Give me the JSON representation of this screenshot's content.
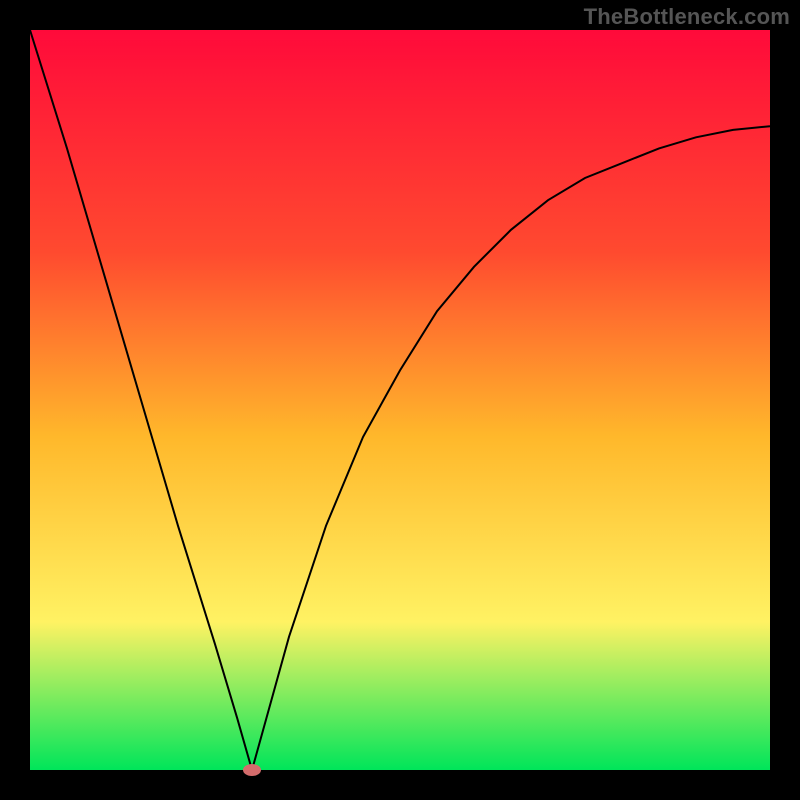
{
  "watermark": "TheBottleneck.com",
  "colors": {
    "bg_black": "#000000",
    "grad_top": "#ff0a3a",
    "grad_upper": "#ff4a2f",
    "grad_mid": "#ffb82b",
    "grad_lower": "#fff263",
    "grad_bottom": "#00e55a",
    "curve": "#000000",
    "dot": "#d46c6c"
  },
  "chart_data": {
    "type": "line",
    "title": "",
    "xlabel": "",
    "ylabel": "",
    "xlim": [
      0,
      100
    ],
    "ylim": [
      0,
      100
    ],
    "series": [
      {
        "name": "curve",
        "x": [
          0,
          5,
          10,
          15,
          20,
          25,
          28,
          30,
          35,
          40,
          45,
          50,
          55,
          60,
          65,
          70,
          75,
          80,
          85,
          90,
          95,
          100
        ],
        "y": [
          100,
          84,
          67,
          50,
          33,
          17,
          7,
          0,
          18,
          33,
          45,
          54,
          62,
          68,
          73,
          77,
          80,
          82,
          84,
          85.5,
          86.5,
          87
        ]
      }
    ],
    "annotations": [
      {
        "name": "min-dot",
        "x": 30,
        "y": 0
      }
    ]
  }
}
